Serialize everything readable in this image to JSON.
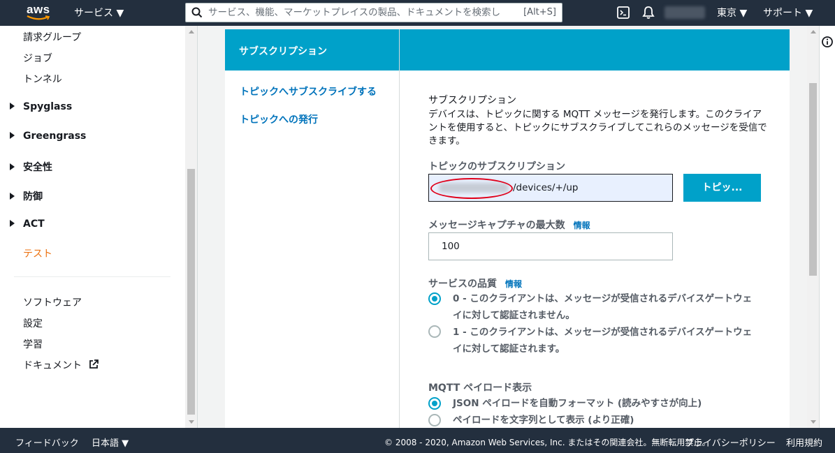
{
  "topbar": {
    "logo_text": "aws",
    "services_label": "サービス ▼",
    "search_placeholder": "サービス、機能、マーケットプレイスの製品、ドキュメントを検索し",
    "search_shortcut": "[Alt+S]",
    "region_label": "東京 ▼",
    "support_label": "サポート ▼"
  },
  "sidebar": {
    "items_top": [
      "請求グループ",
      "ジョブ",
      "トンネル"
    ],
    "groups": [
      "Spyglass",
      "Greengrass",
      "安全性",
      "防御",
      "ACT"
    ],
    "active_item": "テスト",
    "items_bottom": [
      "ソフトウェア",
      "設定",
      "学習",
      "ドキュメント"
    ]
  },
  "panel": {
    "header_title": "サブスクリプション",
    "nav_links": [
      "トピックへサブスクライブする",
      "トピックへの発行"
    ],
    "section_title": "サブスクリプション",
    "section_desc": "デバイスは、トピックに関する MQTT メッセージを発行します。このクライアントを使用すると、トピックにサブスクライブしてこれらのメッセージを受信できます。",
    "topic_label": "トピックのサブスクリプション",
    "topic_value": "/devices/+/up",
    "subscribe_button": "トピッ...",
    "max_label": "メッセージキャプチャの最大数",
    "info_label": "情報",
    "max_value": "100",
    "qos_label": "サービスの品質",
    "qos_options": [
      "0 - このクライアントは、メッセージが受信されるデバイスゲートウェイに対して認証されません。",
      "1 - このクライアントは、メッセージが受信されるデバイスゲートウェイに対して認証されます。"
    ],
    "qos_selected": 0,
    "payload_label": "MQTT ペイロード表示",
    "payload_options": [
      "JSON ペイロードを自動フォーマット (読みやすさが向上)",
      "ペイロードを文字列として表示 (より正確)"
    ],
    "payload_selected": 0
  },
  "footer": {
    "feedback": "フィードバック",
    "language": "日本語 ▼",
    "copyright": "© 2008 - 2020, Amazon Web Services, Inc. またはその関連会社。無断転用禁止。",
    "privacy": "プライバシーポリシー",
    "terms": "利用規約"
  },
  "colors": {
    "nav_bg": "#232f3e",
    "accent": "#00a1c9",
    "active": "#ec7211",
    "link": "#0073bb"
  }
}
